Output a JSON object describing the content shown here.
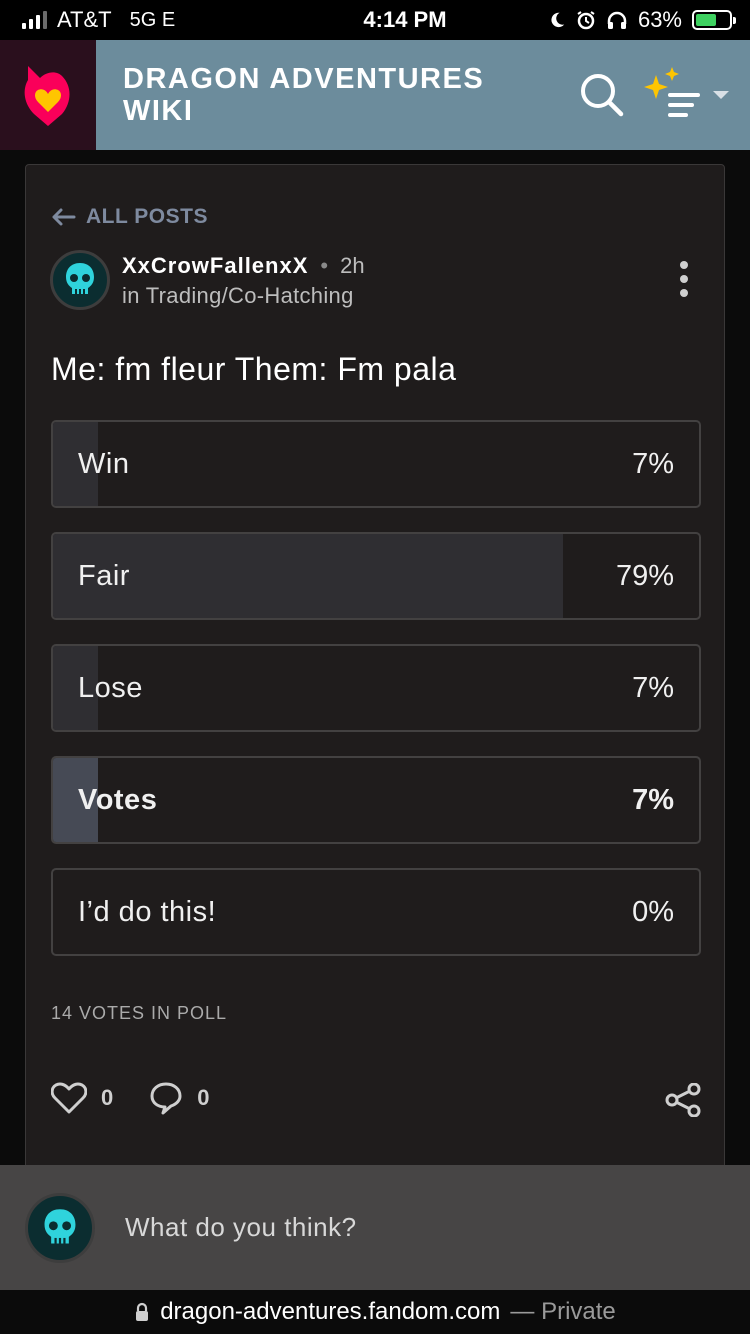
{
  "status_bar": {
    "carrier": "AT&T",
    "network": "5G E",
    "time": "4:14 PM",
    "battery_percent": "63%",
    "icons": [
      "signal-icon",
      "moon-icon",
      "alarm-icon",
      "headphones-icon",
      "battery-icon"
    ]
  },
  "header": {
    "wiki_title": "DRAGON ADVENTURES WIKI",
    "icons": [
      "fandom-logo",
      "search-icon",
      "sparkle-menu-icon",
      "chevron-down-icon"
    ]
  },
  "post": {
    "back_label": "ALL POSTS",
    "author": "XxCrowFallenxX",
    "separator": "•",
    "time_ago": "2h",
    "category": "in Trading/Co-Hatching",
    "title": "Me: fm fleur Them: Fm pala"
  },
  "poll": {
    "options": [
      {
        "label": "Win",
        "percent": "7%",
        "value": 7,
        "selected": false
      },
      {
        "label": "Fair",
        "percent": "79%",
        "value": 79,
        "selected": false
      },
      {
        "label": "Lose",
        "percent": "7%",
        "value": 7,
        "selected": false
      },
      {
        "label": "Votes",
        "percent": "7%",
        "value": 7,
        "selected": true
      },
      {
        "label": "I’d do this!",
        "percent": "0%",
        "value": 0,
        "selected": false
      }
    ],
    "vote_count_label": "14 VOTES IN POLL"
  },
  "actions": {
    "likes": "0",
    "comments": "0"
  },
  "reply": {
    "placeholder": "What do you think?"
  },
  "url_bar": {
    "domain": "dragon-adventures.fandom.com",
    "mode": "— Private"
  },
  "colors": {
    "header_bg": "#6c8c9c",
    "card_bg": "#1f1c1c",
    "accent_link": "#7e8a9f",
    "avatar_cyan": "#2fd3dc",
    "fandom_red": "#fa005a",
    "fandom_yellow": "#ffc500"
  }
}
